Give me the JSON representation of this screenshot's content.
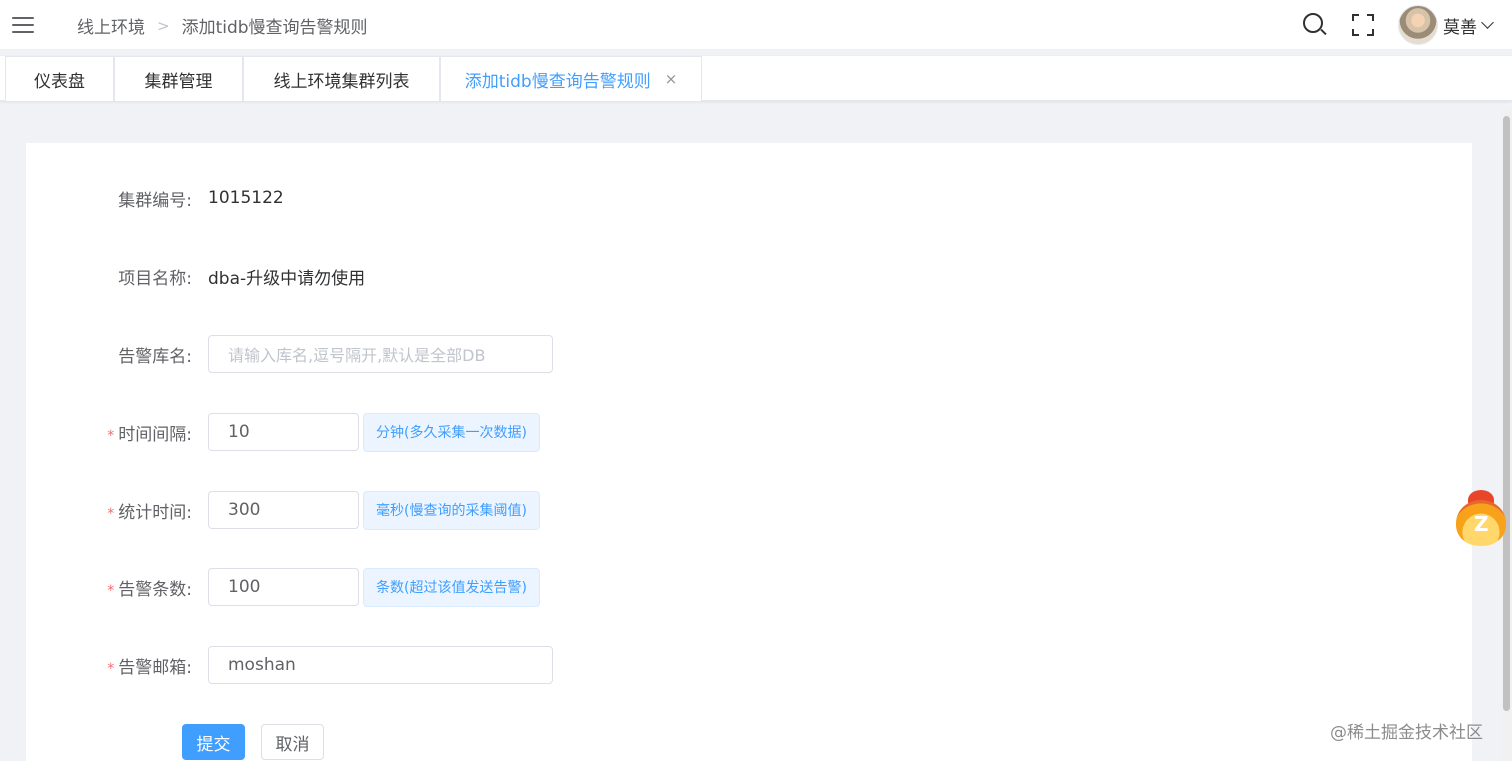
{
  "header": {
    "breadcrumb": [
      "线上环境",
      "添加tidb慢查询告警规则"
    ],
    "user_name": "莫善"
  },
  "tabs": [
    {
      "label": "仪表盘"
    },
    {
      "label": "集群管理"
    },
    {
      "label": "线上环境集群列表"
    },
    {
      "label": "添加tidb慢查询告警规则",
      "active": true,
      "close": "×"
    }
  ],
  "form": {
    "cluster_id": {
      "label": "集群编号:",
      "value": "1015122"
    },
    "project_name": {
      "label": "项目名称:",
      "value": "dba-升级中请勿使用"
    },
    "alert_db": {
      "label": "告警库名:",
      "placeholder": "请输入库名,逗号隔开,默认是全部DB"
    },
    "interval": {
      "label": "时间间隔:",
      "value": "10",
      "hint": "分钟(多久采集一次数据)"
    },
    "stat_time": {
      "label": "统计时间:",
      "value": "300",
      "hint": "毫秒(慢查询的采集阈值)"
    },
    "alert_count": {
      "label": "告警条数:",
      "value": "100",
      "hint": "条数(超过该值发送告警)"
    },
    "alert_email": {
      "label": "告警邮箱:",
      "value": "moshan"
    },
    "required_mark": "*",
    "submit_label": "提交",
    "cancel_label": "取消"
  },
  "watermark": "@稀土掘金技术社区",
  "colors": {
    "primary": "#409eff",
    "required": "#f56c6c",
    "hint_bg": "#ecf5ff"
  }
}
